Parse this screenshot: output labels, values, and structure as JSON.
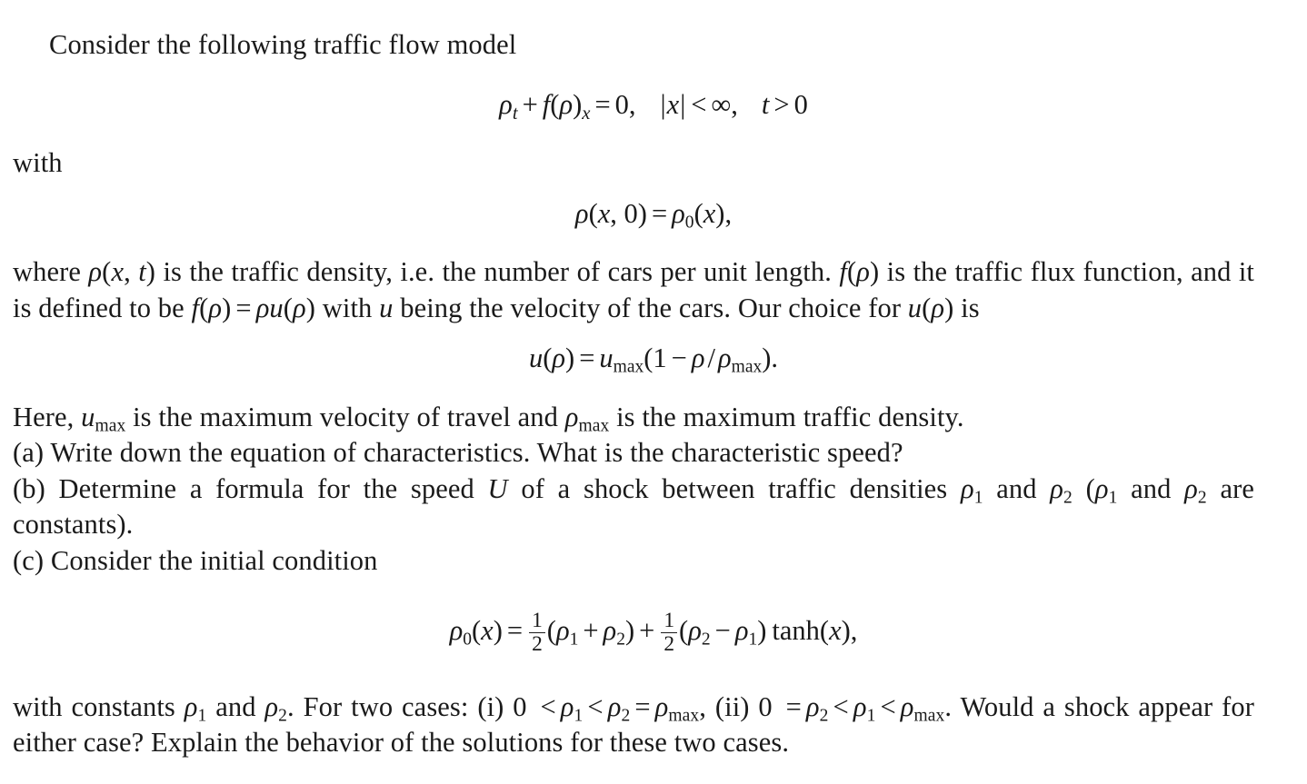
{
  "document": {
    "type": "mathematics-problem",
    "subject": "traffic flow model",
    "background_color": "#ffffff",
    "text_color": "#1a1a1a"
  },
  "intro": {
    "line": "Consider the following traffic flow model"
  },
  "equation_pde": {
    "label": "conservation-law",
    "lhs": "ρ",
    "sub_t": "t",
    "plus": "+",
    "f": "f",
    "open": "(",
    "rho": "ρ",
    "close": ")",
    "sub_x": "x",
    "equals": "=",
    "zero": "0",
    "comma": ",",
    "abs_open": "|",
    "x": "x",
    "abs_close": "|",
    "lt": "<",
    "infinity": "∞",
    "comma2": ",",
    "t": "t",
    "gt": ">",
    "zero2": "0"
  },
  "with_line": {
    "text": "with"
  },
  "equation_ic": {
    "label": "initial-condition",
    "rho": "ρ",
    "open": "(",
    "x": "x",
    "comma": ",",
    "zero": "0",
    "close": ")",
    "equals": "=",
    "rho0": "ρ",
    "sub0": "0",
    "open2": "(",
    "x2": "x",
    "close2": ")",
    "trailing_comma": ","
  },
  "paragraph_where": {
    "seg1": "where ",
    "m_rho": "ρ",
    "m_open": "(",
    "m_x": "x",
    "m_comma": ",",
    "m_t": "t",
    "m_close": ")",
    "seg2": " is the traffic density, i.e. the number of cars per unit length. ",
    "m_f": "f",
    "m_fopen": "(",
    "m_frho": "ρ",
    "m_fclose": ")",
    "seg3": " is the traffic flux function, and it is defined to be ",
    "m_f2": "f",
    "m_f2open": "(",
    "m_f2rho": "ρ",
    "m_f2close": ")",
    "m_eq": "=",
    "m_rhou": "ρu",
    "m_uopen": "(",
    "m_urho": "ρ",
    "m_uclose": ")",
    "seg4": " with ",
    "m_u": "u",
    "seg5": " being the velocity of the cars. Our choice for ",
    "m_u2": "u",
    "m_u2open": "(",
    "m_u2rho": "ρ",
    "m_u2close": ")",
    "seg6": " is"
  },
  "equation_u": {
    "label": "velocity-relation",
    "u": "u",
    "open": "(",
    "rho": "ρ",
    "close": ")",
    "equals": "=",
    "umax_base": "u",
    "umax_sub": "max",
    "open2": "(",
    "one": "1",
    "minus": "−",
    "rho2": "ρ",
    "slash": "/",
    "rhomax_base": "ρ",
    "rhomax_sub": "max",
    "close2": ")",
    "period": "."
  },
  "paragraph_here": {
    "seg1": "Here, ",
    "umax_base": "u",
    "umax_sub": "max",
    "seg2": " is the maximum velocity of travel and ",
    "rhomax_base": "ρ",
    "rhomax_sub": "max",
    "seg3": " is the maximum traffic density."
  },
  "part_a": {
    "text": "(a) Write down the equation of characteristics. What is the characteristic speed?"
  },
  "part_b": {
    "seg1": "(b) Determine a formula for the speed ",
    "m_U": "U",
    "seg2": " of a shock between traffic densities ",
    "m_rho1_base": "ρ",
    "m_rho1_sub": "1",
    "seg3": " and ",
    "m_rho2_base": "ρ",
    "m_rho2_sub": "2",
    "seg4": " (",
    "m_rho1b_base": "ρ",
    "m_rho1b_sub": "1",
    "seg5": " and ",
    "m_rho2b_base": "ρ",
    "m_rho2b_sub": "2",
    "seg6": " are constants)."
  },
  "part_c": {
    "text": "(c) Consider the initial condition"
  },
  "equation_rho0": {
    "label": "initial-profile",
    "rho0_base": "ρ",
    "rho0_sub": "0",
    "open": "(",
    "x": "x",
    "close": ")",
    "equals": "=",
    "frac1_num": "1",
    "frac1_den": "2",
    "open2": "(",
    "rho1_base": "ρ",
    "rho1_sub": "1",
    "plus": "+",
    "rho2_base": "ρ",
    "rho2_sub": "2",
    "close2": ")",
    "plus2": "+",
    "frac2_num": "1",
    "frac2_den": "2",
    "open3": "(",
    "rho2b_base": "ρ",
    "rho2b_sub": "2",
    "minus": "−",
    "rho1b_base": "ρ",
    "rho1b_sub": "1",
    "close3": ")",
    "tanh": "tanh",
    "open4": "(",
    "x2": "x",
    "close4": ")",
    "trailing_comma": ","
  },
  "paragraph_cases": {
    "seg1": "with constants ",
    "rho1_base": "ρ",
    "rho1_sub": "1",
    "seg2": " and ",
    "rho2_base": "ρ",
    "rho2_sub": "2",
    "seg3": ". For two cases: (i) 0 ",
    "lt1": "<",
    "c1_rho1_base": "ρ",
    "c1_rho1_sub": "1",
    "lt2": "<",
    "c1_rho2_base": "ρ",
    "c1_rho2_sub": "2",
    "eq1": "=",
    "c1_rhomax_base": "ρ",
    "c1_rhomax_sub": "max",
    "seg4": ", (ii) 0 ",
    "eq2": "=",
    "c2_rho2_base": "ρ",
    "c2_rho2_sub": "2",
    "lt3": "<",
    "c2_rho1_base": "ρ",
    "c2_rho1_sub": "1",
    "lt4": "<",
    "c2_rhomax_base": "ρ",
    "c2_rhomax_sub": "max",
    "seg5": ". Would a shock appear for either case? Explain the behavior of the solutions for these two cases."
  }
}
